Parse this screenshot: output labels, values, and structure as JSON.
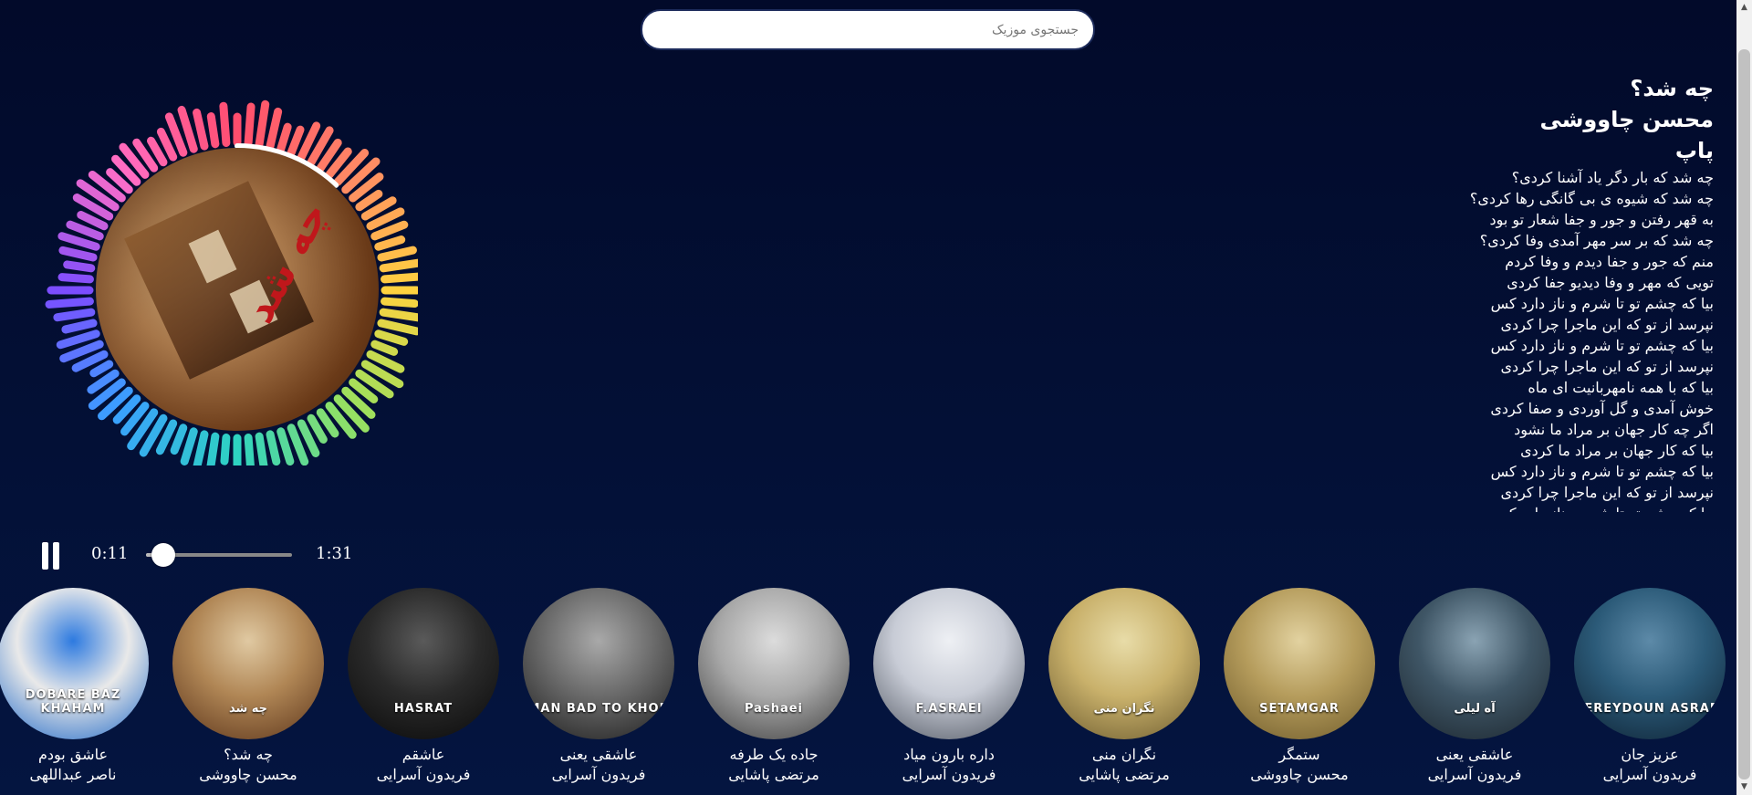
{
  "search": {
    "placeholder": "جستجوی موزیک",
    "value": ""
  },
  "now_playing": {
    "title": "چه شد؟",
    "artist": "محسن چاووشی",
    "genre": "پاپ",
    "cover_text": "چه شد",
    "lyrics": [
      "چه شد که بار دگر یاد آشنا کردی؟",
      "چه شد که شیوه ی بی گانگی رها کردی؟",
      "به قهر رفتن و جور و جفا شعار تو بود",
      "چه شد که بر سر مهر آمدی وفا کردی؟",
      "منم که جور و جفا دیدم و وفا کردم",
      "تویی که مهر و وفا دیدیو جفا کردی",
      "بیا که چشم تو تا شرم و ناز دارد کس",
      "نپرسد از تو که این ماجرا چرا کردی",
      "بیا که چشم تو تا شرم و ناز دارد کس",
      "نپرسد از تو که این ماجرا چرا کردی",
      "بیا که با همه نامهربانیت ای ماه",
      "خوش آمدی و گل آوردی و صفا کردی",
      "اگر چه کار جهان بر مراد ما نشود",
      "بیا که کار جهان بر مراد ما کردی",
      "بیا که چشم تو تا شرم و ناز دارد کس",
      "نپرسد از تو که این ماجرا چرا کردی",
      "بیا که چشم تو تا شرم و ناز دارد کس"
    ]
  },
  "player": {
    "current_time": "0:11",
    "total_time": "1:31",
    "progress": 0.12,
    "state": "playing",
    "icon": "pause-icon"
  },
  "visualizer": {
    "progress_arc": 0.12,
    "colors": [
      "#ff4d6d",
      "#ff8a65",
      "#ffd23f",
      "#9be15d",
      "#2ed3c1",
      "#3aa0ff",
      "#7c4dff",
      "#ff6ec7"
    ]
  },
  "tracks": [
    {
      "title": "عزیز جان",
      "artist": "فریدون آسرایی",
      "cover_text": "FEREYDOUN ASRAEI",
      "colors": [
        "#2b5a78",
        "#0e2233",
        "#5d8aa8"
      ]
    },
    {
      "title": "عاشقی یعنی",
      "artist": "فریدون آسرایی",
      "cover_text": "آه لیلی",
      "colors": [
        "#3f5666",
        "#1b252d",
        "#8aa3b3"
      ]
    },
    {
      "title": "ستمگر",
      "artist": "محسن چاووشی",
      "cover_text": "SETAMGAR",
      "colors": [
        "#b59c5c",
        "#6e5a2a",
        "#e2d2a0"
      ]
    },
    {
      "title": "نگران منی",
      "artist": "مرتضی پاشایی",
      "cover_text": "نگران منی",
      "colors": [
        "#c9b16b",
        "#6b5a2e",
        "#e8dca8"
      ]
    },
    {
      "title": "داره بارون میاد",
      "artist": "فریدون آسرایی",
      "cover_text": "F.ASRAEI",
      "colors": [
        "#c8ccd6",
        "#4f5560",
        "#eef0f4"
      ]
    },
    {
      "title": "جاده یک طرفه",
      "artist": "مرتضی پاشایی",
      "cover_text": "Pashaei",
      "colors": [
        "#a8a8a8",
        "#3d3d3d",
        "#dcdcdc"
      ]
    },
    {
      "title": "عاشقی یعنی",
      "artist": "فریدون آسرایی",
      "cover_text": "MAN BAD TO KHOB",
      "colors": [
        "#6a6a6a",
        "#1c1c1c",
        "#a9a9a9"
      ]
    },
    {
      "title": "عاشقم",
      "artist": "فریدون آسرایی",
      "cover_text": "HASRAT",
      "colors": [
        "#2a2a2a",
        "#090909",
        "#5a5a5a"
      ]
    },
    {
      "title": "چه شد؟",
      "artist": "محسن چاووشی",
      "cover_text": "چه شد",
      "colors": [
        "#b08655",
        "#5b341a",
        "#e0c9a2"
      ]
    },
    {
      "title": "عاشق بودم",
      "artist": "ناصر عبداللهی",
      "cover_text": "DOBARE BAZ KHAHAM",
      "colors": [
        "#e9e9e9",
        "#1b66c7",
        "#2d7ae0"
      ]
    }
  ]
}
